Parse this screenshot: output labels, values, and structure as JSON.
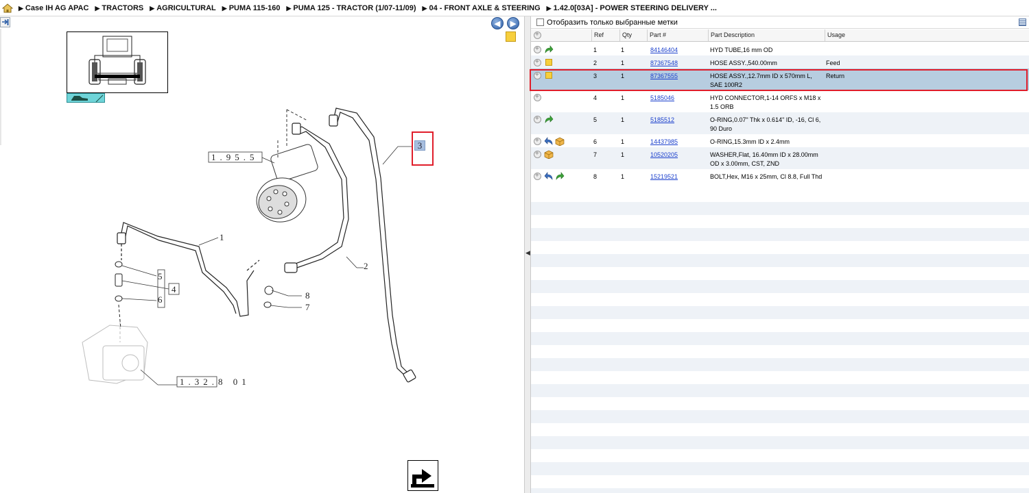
{
  "breadcrumb": [
    "Case IH AG APAC",
    "TRACTORS",
    "AGRICULTURAL",
    "PUMA 115-160",
    "PUMA 125 - TRACTOR (1/07-11/09)",
    "04 - FRONT AXLE & STEERING",
    "1.42.0[03A] - POWER STEERING DELIVERY ..."
  ],
  "filter": {
    "label": "Отобразить только выбранные метки"
  },
  "columns": [
    "Ref",
    "Qty",
    "Part #",
    "Part Description",
    "Usage"
  ],
  "rows": [
    {
      "ref": "1",
      "qty": "1",
      "part": "84146404",
      "desc": "HYD TUBE,16 mm OD",
      "usage": "",
      "icons": [
        "arrow-green-icon"
      ]
    },
    {
      "ref": "2",
      "qty": "1",
      "part": "87367548",
      "desc": "HOSE ASSY.,540.00mm",
      "usage": "Feed",
      "icons": [
        "note-icon"
      ]
    },
    {
      "ref": "3",
      "qty": "1",
      "part": "87367555",
      "desc": "HOSE ASSY.,12.7mm ID x 570mm L, SAE 100R2",
      "usage": "Return",
      "icons": [
        "note-icon"
      ]
    },
    {
      "ref": "4",
      "qty": "1",
      "part": "5185046",
      "desc": "HYD CONNECTOR,1-14 ORFS x M18 x 1.5 ORB",
      "usage": "",
      "icons": []
    },
    {
      "ref": "5",
      "qty": "1",
      "part": "5185512",
      "desc": "O-RING,0.07\" Thk x 0.614\" ID, -16, Cl 6, 90 Duro",
      "usage": "",
      "icons": [
        "arrow-green-icon"
      ]
    },
    {
      "ref": "6",
      "qty": "1",
      "part": "14437985",
      "desc": "O-RING,15.3mm ID x 2.4mm",
      "usage": "",
      "icons": [
        "arrow-blue-icon",
        "box-icon"
      ]
    },
    {
      "ref": "7",
      "qty": "1",
      "part": "10520205",
      "desc": "WASHER,Flat, 16.40mm ID x 28.00mm OD x 3.00mm, CST, ZND",
      "usage": "",
      "icons": [
        "box-icon"
      ]
    },
    {
      "ref": "8",
      "qty": "1",
      "part": "15219521",
      "desc": "BOLT,Hex, M16 x 25mm, Cl 8.8, Full Thd",
      "usage": "",
      "icons": [
        "arrow-blue-icon",
        "arrow-green-icon"
      ]
    }
  ],
  "selected_ref": "3",
  "diagram": {
    "callouts": [
      "1",
      "2",
      "3",
      "4",
      "5",
      "6",
      "7",
      "8"
    ],
    "refs": {
      "ref_195": "1.95.5",
      "ref_132": "1.32.8 01"
    }
  },
  "colors": {
    "selection_row": "#b7cde0",
    "highlight_border": "#e01d2a",
    "link": "#1a3fcc",
    "alt_row": "#eef2f7"
  }
}
